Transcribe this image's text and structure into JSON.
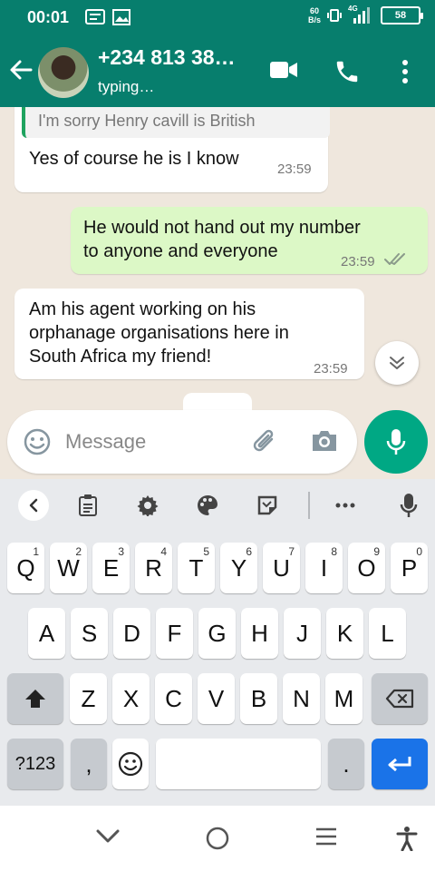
{
  "status_bar": {
    "time": "00:01",
    "speed_value": "60",
    "speed_unit": "B/s",
    "network": "4G",
    "battery": "58"
  },
  "header": {
    "contact": "+234 813 38…",
    "status": "typing…"
  },
  "messages": {
    "m1": {
      "quote": "I'm sorry Henry cavill is British",
      "text": "Yes of course he is I know",
      "time": "23:59"
    },
    "m2": {
      "line1": "He would not hand out my number",
      "line2": "to anyone and everyone",
      "time": "23:59"
    },
    "m3": {
      "line1": "Am his agent working on his",
      "line2": "orphanage organisations here in",
      "line3": "South Africa my friend!",
      "time": "23:59"
    }
  },
  "composer": {
    "placeholder": "Message"
  },
  "keyboard": {
    "row1": [
      "Q",
      "W",
      "E",
      "R",
      "T",
      "Y",
      "U",
      "I",
      "O",
      "P"
    ],
    "row1_digits": [
      "1",
      "2",
      "3",
      "4",
      "5",
      "6",
      "7",
      "8",
      "9",
      "0"
    ],
    "row2": [
      "A",
      "S",
      "D",
      "F",
      "G",
      "H",
      "J",
      "K",
      "L"
    ],
    "row3": [
      "Z",
      "X",
      "C",
      "V",
      "B",
      "N",
      "M"
    ],
    "symbols": "?123",
    "comma": ",",
    "period": "."
  },
  "colors": {
    "header": "#077e6d",
    "accent": "#00a884",
    "outgoing": "#dcf8c6",
    "enter_key": "#1a73e8"
  }
}
